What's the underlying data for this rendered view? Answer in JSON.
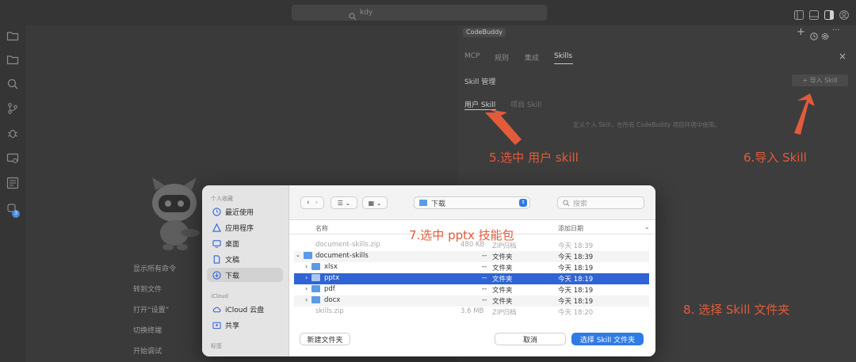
{
  "titlebar": {
    "search_text": "kdy",
    "back": "‹",
    "forward": "›"
  },
  "editor": {
    "commands": [
      "显示所有命令",
      "转到文件",
      "打开“设置”",
      "切换终端",
      "开始调试"
    ],
    "badge": "3"
  },
  "panel": {
    "app_name": "CodeBuddy",
    "tabs": [
      "MCP",
      "规则",
      "集成",
      "Skills"
    ],
    "active_tab": "Skills",
    "section_title": "Skill 管理",
    "import_button": "+ 导入 Skill",
    "subtabs": [
      "用户 Skill",
      "项目 Skill"
    ],
    "empty_text": "定义个人 Skill，在所有 CodeBuddy 项目环境中使用。"
  },
  "annotations": {
    "step5": "5.选中 用户 skill",
    "step6": "6.导入 Skill",
    "step7": "7.选中 pptx 技能包",
    "step8": "8. 选择 Skill 文件夹"
  },
  "dialog": {
    "sidebar": {
      "favorites_header": "个人收藏",
      "favorites": [
        "最近使用",
        "应用程序",
        "桌面",
        "文稿",
        "下载"
      ],
      "selected": "下载",
      "icloud_header": "iCloud",
      "icloud": [
        "iCloud 云盘",
        "共享"
      ],
      "tags_header": "标签"
    },
    "location": "下载",
    "search_placeholder": "搜索",
    "columns": {
      "name": "名称",
      "date": "添加日期"
    },
    "rows": [
      {
        "name": "document-skills.zip",
        "size": "480 KB",
        "kind": "ZIP归档",
        "date": "今天 18:39"
      },
      {
        "name": "document-skills",
        "size": "--",
        "kind": "文件夹",
        "date": "今天 18:39"
      },
      {
        "name": "xlsx",
        "size": "--",
        "kind": "文件夹",
        "date": "今天 18:19"
      },
      {
        "name": "pptx",
        "size": "--",
        "kind": "文件夹",
        "date": "今天 18:19"
      },
      {
        "name": "pdf",
        "size": "--",
        "kind": "文件夹",
        "date": "今天 18:19"
      },
      {
        "name": "docx",
        "size": "--",
        "kind": "文件夹",
        "date": "今天 18:19"
      },
      {
        "name": "skills.zip",
        "size": "3.6 MB",
        "kind": "ZIP归档",
        "date": "今天 18:20"
      }
    ],
    "new_folder_button": "新建文件夹",
    "cancel_button": "取消",
    "select_button": "选择 Skill 文件夹"
  },
  "colors": {
    "annotation": "#e35b3b",
    "selection": "#2f64d4"
  }
}
